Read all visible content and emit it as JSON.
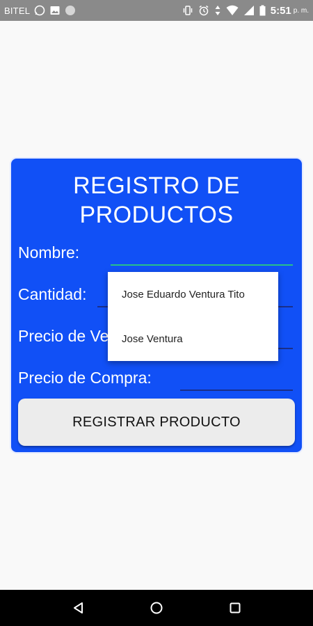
{
  "status_bar": {
    "carrier": "BITEL",
    "time": "5:51",
    "ampm": "p. m.",
    "icons": [
      "whatsapp-icon",
      "image-icon",
      "circle-icon",
      "vibrate-icon",
      "alarm-icon",
      "data-arrows-icon",
      "wifi-icon",
      "signal-icon",
      "battery-icon"
    ]
  },
  "form": {
    "title_line1": "REGISTRO DE",
    "title_line2": "PRODUCTOS",
    "nombre_label": "Nombre:",
    "cantidad_label": "Cantidad:",
    "precio_venta_label": "Precio de Ve",
    "precio_compra_label": "Precio de Compra:",
    "register_button": "REGISTRAR PRODUCTO",
    "accent_color": "#1150f6"
  },
  "autocomplete": {
    "items": [
      "Jose Eduardo Ventura Tito",
      "Jose Ventura"
    ]
  },
  "nav_bar": {
    "icons": [
      "back-icon",
      "home-icon",
      "recents-icon"
    ]
  }
}
